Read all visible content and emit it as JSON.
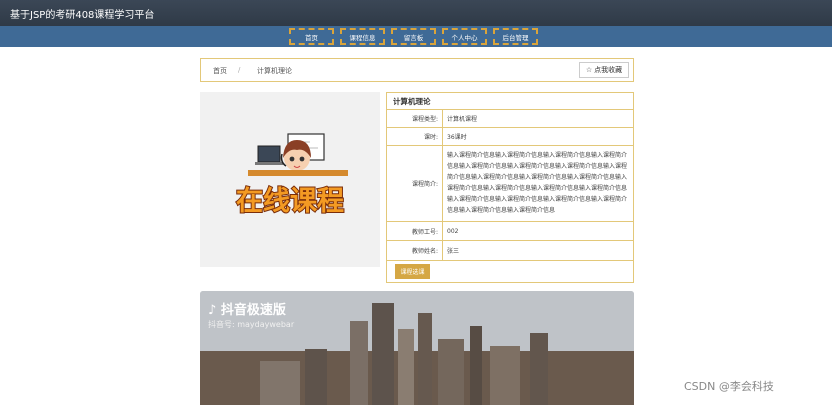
{
  "site": {
    "title": "基于JSP的考研408课程学习平台"
  },
  "nav": {
    "items": [
      "首页",
      "课程信息",
      "留言板",
      "个人中心",
      "后台管理"
    ]
  },
  "breadcrumb": {
    "home": "首页",
    "separator": "/",
    "current": "计算机理论"
  },
  "favorite": {
    "label": "点我收藏",
    "icon": "star-icon"
  },
  "course": {
    "image_text": "在线课程",
    "title": "计算机理论",
    "fields": [
      {
        "label": "课程类型:",
        "value": "计算机课程"
      },
      {
        "label": "课时:",
        "value": "36课时"
      },
      {
        "label": "课程简介:",
        "value": "输入课程简介信息输入课程简介信息输入课程简介信息输入课程简介信息输入课程简介信息输入课程简介信息输入课程简介信息输入课程简介信息输入课程简介信息输入课程简介信息输入课程简介信息输入课程简介信息输入课程简介信息输入课程简介信息输入课程简介信息输入课程简介信息输入课程简介信息输入课程简介信息输入课程简介信息输入课程简介信息输入课程简介信息"
      },
      {
        "label": "教师工号:",
        "value": "002"
      },
      {
        "label": "教师姓名:",
        "value": "张三"
      }
    ],
    "choose_button": "课程选课"
  },
  "video": {
    "brand": "抖音极速版",
    "account": "抖音号: maydaywebar"
  },
  "watermark": "CSDN @李会科技",
  "colors": {
    "topbar": "#2f3a47",
    "navbar": "#3f6a96",
    "accent": "#d5a744",
    "border": "#e3c879"
  }
}
